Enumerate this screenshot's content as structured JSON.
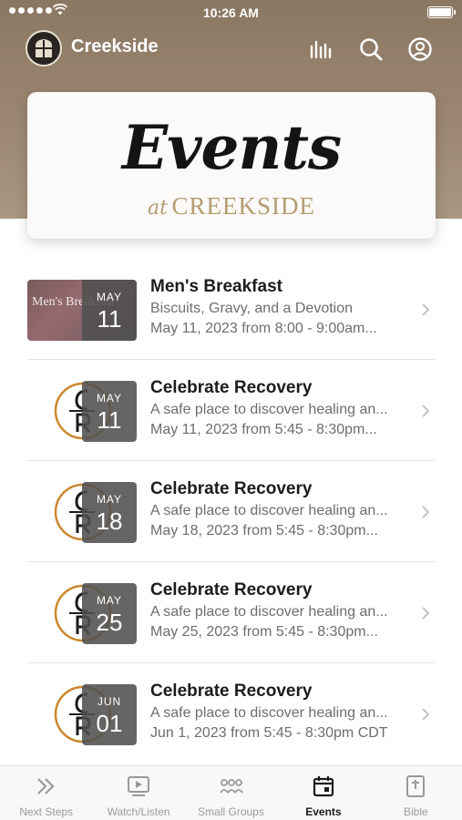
{
  "status_bar": {
    "time": "10:26 AM"
  },
  "header": {
    "title": "Creekside",
    "icons": [
      "audio-bars-icon",
      "search-icon",
      "account-icon"
    ]
  },
  "banner": {
    "script_text": "Events",
    "sub_at": "at",
    "sub_place": "CREEKSIDE"
  },
  "events": [
    {
      "title": "Men's Breakfast",
      "description": "Biscuits, Gravy, and a Devotion",
      "time": "May 11, 2023 from 8:00 - 9:00am...",
      "month": "MAY",
      "day": "11",
      "thumb_text": "Men's Breakfast",
      "thumb": "photo"
    },
    {
      "title": "Celebrate Recovery",
      "description": "A safe place to discover healing an...",
      "time": "May 11, 2023 from 5:45 - 8:30pm...",
      "month": "MAY",
      "day": "11",
      "thumb": "cr-logo"
    },
    {
      "title": "Celebrate Recovery",
      "description": "A safe place to discover healing an...",
      "time": "May 18, 2023 from 5:45 - 8:30pm...",
      "month": "MAY",
      "day": "18",
      "thumb": "cr-logo"
    },
    {
      "title": "Celebrate Recovery",
      "description": "A safe place to discover healing an...",
      "time": "May 25, 2023 from 5:45 - 8:30pm...",
      "month": "MAY",
      "day": "25",
      "thumb": "cr-logo"
    },
    {
      "title": "Celebrate Recovery",
      "description": "A safe place to discover healing an...",
      "time": "Jun 1, 2023 from 5:45 - 8:30pm CDT",
      "month": "JUN",
      "day": "01",
      "thumb": "cr-logo"
    }
  ],
  "tabs": [
    {
      "label": "Next Steps",
      "icon": "double-chevron-icon",
      "active": false
    },
    {
      "label": "Watch/Listen",
      "icon": "play-screen-icon",
      "active": false
    },
    {
      "label": "Small Groups",
      "icon": "group-icon",
      "active": false
    },
    {
      "label": "Events",
      "icon": "calendar-icon",
      "active": true
    },
    {
      "label": "Bible",
      "icon": "bible-icon",
      "active": false
    }
  ],
  "colors": {
    "header_bg": "#9a8670",
    "accent_gold": "#b49c72",
    "cr_ring": "#c9882e",
    "date_badge": "#505050"
  }
}
